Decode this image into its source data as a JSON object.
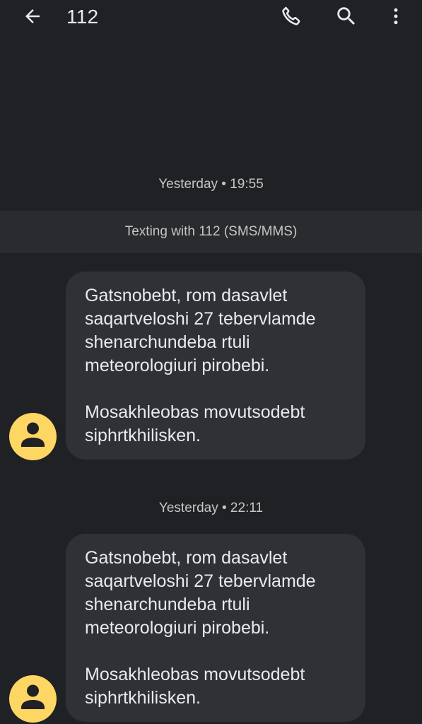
{
  "header": {
    "title": "112",
    "icons": {
      "back": "arrow-back-icon",
      "call": "phone-icon",
      "search": "search-icon",
      "more": "more-vert-icon"
    }
  },
  "banner": {
    "text": "Texting with 112 (SMS/MMS)"
  },
  "messages": [
    {
      "timestamp": "Yesterday • 19:55",
      "text": "Gatsnobebt,  rom dasavlet saqartveloshi 27 tebervlamde shenarchundeba rtuli meteorologiuri pirobebi.\n\nMosakhleobas movutsodebt siphrtkhilisken.",
      "avatar_icon": "person-icon"
    },
    {
      "timestamp": "Yesterday • 22:11",
      "text": "Gatsnobebt,  rom dasavlet saqartveloshi 27 tebervlamde shenarchundeba rtuli meteorologiuri pirobebi.\n\nMosakhleobas movutsodebt siphrtkhilisken.",
      "avatar_icon": "person-icon"
    }
  ],
  "colors": {
    "background": "#202124",
    "bubble": "#303134",
    "avatar": "#fdd663",
    "text": "#e8eaed"
  }
}
